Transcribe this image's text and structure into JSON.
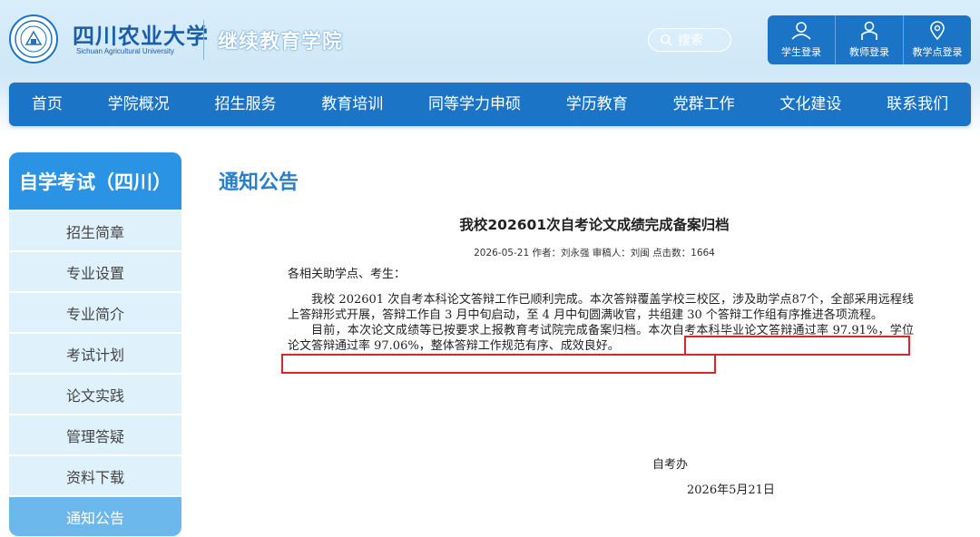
{
  "header": {
    "logo_cn": "四川农业大学",
    "logo_en": "Sichuan Agricultural University",
    "college_name": "继续教育学院",
    "search_placeholder": "搜索",
    "logins": [
      {
        "label": "学生登录",
        "icon": "user-icon"
      },
      {
        "label": "教师登录",
        "icon": "teacher-icon"
      },
      {
        "label": "教学点登录",
        "icon": "location-pin-icon"
      }
    ]
  },
  "nav": {
    "items": [
      "首页",
      "学院概况",
      "招生服务",
      "教育培训",
      "同等学力申硕",
      "学历教育",
      "党群工作",
      "文化建设",
      "联系我们"
    ]
  },
  "sidebar": {
    "title": "自学考试（四川）",
    "items": [
      "招生简章",
      "专业设置",
      "专业简介",
      "考试计划",
      "论文实践",
      "管理答疑",
      "资料下载",
      "通知公告"
    ],
    "active_index": 7
  },
  "main": {
    "section_title": "通知公告",
    "article": {
      "title": "我校202601次自考论文成绩完成备案归档",
      "meta": "2026-05-21 作者：刘永强 审稿人：刘闽 点击数：1664",
      "salutation": "各相关助学点、考生：",
      "paragraph1": "我校 202601 次自考本科论文答辩工作已顺利完成。本次答辩覆盖学校三校区，涉及助学点87个，全部采用远程线上答辩形式开展，答辩工作自 3 月中旬启动，至 4 月中旬圆满收官，共组建 30 个答辩工作组有序推进各项流程。",
      "paragraph2": "目前，本次论文成绩等已按要求上报教育考试院完成备案归档。本次自考本科毕业论文答辩通过率 97.91%，学位论文答辩通过率 97.06%，整体答辩工作规范有序、成效良好。",
      "signoff": "自考办",
      "date": "2026年5月21日"
    }
  },
  "colors": {
    "primary_blue": "#1b74c6",
    "sidebar_title_blue": "#2a93e3",
    "sidebar_item_bg": "#dff1fb",
    "sidebar_active_bg": "#6cb8ec",
    "section_title_blue": "#2a7fc9",
    "highlight_red": "#d9262c"
  }
}
